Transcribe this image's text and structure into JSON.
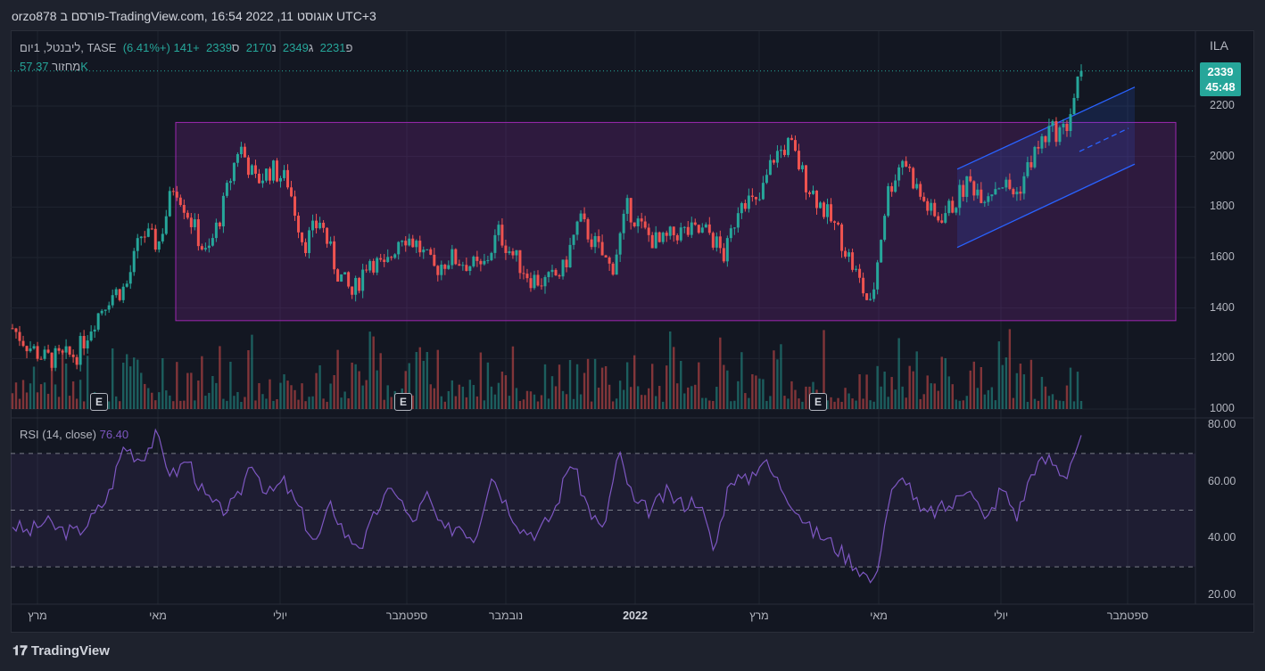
{
  "header": {
    "title": "orzo878 פורסם ב-TradingView.com, 16:54 2022 ,11 אוגוסט UTC+3"
  },
  "legend": {
    "symbol": "ליבנטל, 1יום, TASE",
    "open_label": "פ",
    "open": "2231",
    "high_label": "ג",
    "high": "2349",
    "low_label": "נ",
    "low": "2170",
    "close_label": "ס",
    "close": "2339",
    "change": "+141 (+6.41%)",
    "volume_label": "מחזור",
    "volume": "57.37K",
    "rsi_label": "RSI (14, close)",
    "rsi_value": "76.40"
  },
  "price_axis": {
    "currency": "ILA",
    "last_price": "2339",
    "countdown": "45:48",
    "ticks": [
      "2200",
      "2000",
      "1800",
      "1600",
      "1400",
      "1200",
      "1000"
    ]
  },
  "rsi_axis": {
    "ticks": [
      "80.00",
      "60.00",
      "40.00",
      "20.00"
    ]
  },
  "time_axis": [
    "מרץ",
    "מאי",
    "יולי",
    "ספטמבר",
    "נובמבר",
    "2022",
    "מרץ",
    "מאי",
    "יולי",
    "ספטמבר"
  ],
  "earnings_marker": "E",
  "branding": "TradingView",
  "colors": {
    "up": "#26a69a",
    "down": "#ef5350",
    "rsi": "#7e57c2",
    "rect": "#9c27b0",
    "channel": "#2962ff"
  },
  "chart_data": {
    "type": "candlestick",
    "ylim": [
      1000,
      2400
    ],
    "rsi_ylim": [
      20,
      80
    ],
    "rsi_levels": [
      70,
      50,
      30
    ],
    "price_closes": [
      1320,
      1250,
      1200,
      1200,
      1220,
      1350,
      1450,
      1480,
      1700,
      1650,
      1900,
      1750,
      1600,
      1800,
      2050,
      1900,
      1950,
      1900,
      1650,
      1750,
      1550,
      1450,
      1600,
      1550,
      1700,
      1650,
      1550,
      1600,
      1580,
      1550,
      1700,
      1600,
      1520,
      1500,
      1550,
      1750,
      1650,
      1550,
      1800,
      1700,
      1650,
      1700,
      1700,
      1700,
      1600,
      1850,
      1800,
      2000,
      2050,
      1900,
      1800,
      1700,
      1550,
      1400,
      1850,
      2000,
      1850,
      1750,
      1800,
      1900,
      1850,
      1900,
      1850,
      2000,
      2100,
      2100,
      2339
    ],
    "rsi_values": [
      45,
      42,
      46,
      43,
      42,
      47,
      55,
      73,
      68,
      76,
      62,
      68,
      55,
      50,
      52,
      68,
      55,
      60,
      50,
      38,
      52,
      40,
      38,
      52,
      58,
      45,
      55,
      42,
      45,
      40,
      63,
      52,
      43,
      42,
      50,
      68,
      52,
      42,
      70,
      52,
      50,
      56,
      52,
      54,
      35,
      62,
      60,
      68,
      60,
      52,
      43,
      40,
      35,
      30,
      24,
      55,
      62,
      48,
      50,
      52,
      60,
      45,
      58,
      48,
      65,
      68,
      62,
      76.4
    ],
    "range_box": {
      "top": 2135,
      "bottom": 1350
    },
    "channel": {
      "start": {
        "lower": 1640,
        "upper": 1950
      },
      "end": {
        "lower": 1970,
        "upper": 2275
      }
    }
  }
}
